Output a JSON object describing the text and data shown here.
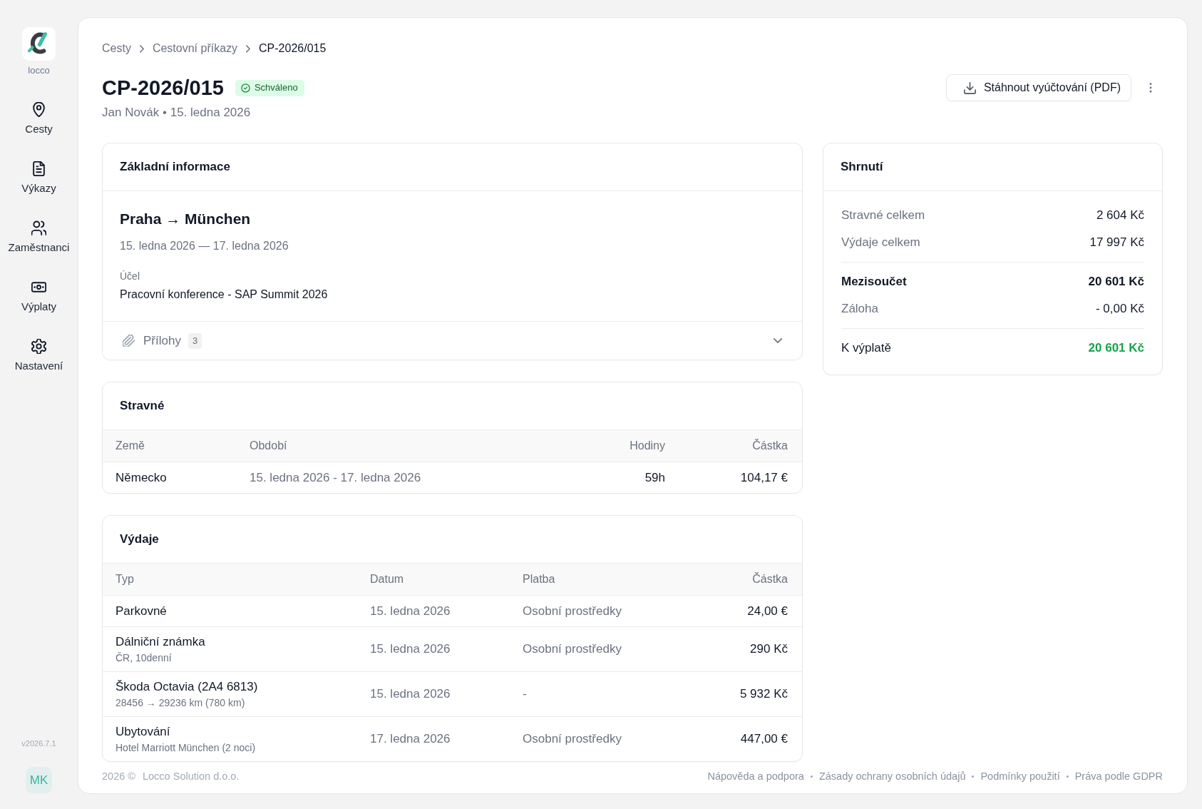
{
  "sidebar": {
    "brand": "locco",
    "items": [
      {
        "label": "Cesty"
      },
      {
        "label": "Výkazy"
      },
      {
        "label": "Zaměstnanci"
      },
      {
        "label": "Výplaty"
      },
      {
        "label": "Nastavení"
      }
    ],
    "version": "v2026.7.1",
    "user_initials": "MK"
  },
  "breadcrumb": [
    "Cesty",
    "Cestovní příkazy",
    "CP-2026/015"
  ],
  "header": {
    "title": "CP-2026/015",
    "status": "Schváleno",
    "subtitle": "Jan Novák • 15. ledna 2026",
    "download_button": "Stáhnout vyúčtování (PDF)"
  },
  "basic_info": {
    "title": "Základní informace",
    "route": "Praha → München",
    "dates": "15. ledna 2026 — 17. ledna 2026",
    "purpose_label": "Účel",
    "purpose": "Pracovní konference - SAP Summit 2026",
    "attachments": {
      "label": "Přílohy",
      "count": "3",
      "expanded": false
    }
  },
  "per_diem": {
    "title": "Stravné",
    "columns": [
      "Země",
      "Období",
      "Hodiny",
      "Částka"
    ],
    "rows": [
      {
        "country": "Německo",
        "period": "15. ledna 2026 - 17. ledna 2026",
        "hours": "59h",
        "amount": "104,17 €"
      }
    ]
  },
  "expenses": {
    "title": "Výdaje",
    "columns": [
      "Typ",
      "Datum",
      "Platba",
      "Částka"
    ],
    "rows": [
      {
        "type": "Parkovné",
        "date": "15. ledna 2026",
        "payment": "Osobní prostředky",
        "amount": "24,00 €"
      },
      {
        "type": "Dálniční známka",
        "detail": "ČR, 10denní",
        "date": "15. ledna 2026",
        "payment": "Osobní prostředky",
        "amount": "290 Kč"
      },
      {
        "type": "Škoda Octavia (2A4 6813)",
        "detail": "28456 → 29236 km (780 km)",
        "date": "15. ledna 2026",
        "payment": "-",
        "amount": "5 932 Kč"
      },
      {
        "type": "Ubytování",
        "detail": "Hotel Marriott München (2 noci)",
        "date": "17. ledna 2026",
        "payment": "Osobní prostředky",
        "amount": "447,00 €"
      }
    ]
  },
  "summary": {
    "title": "Shrnutí",
    "rows": [
      {
        "kind": "item",
        "label": "Stravné celkem",
        "value": "2 604 Kč"
      },
      {
        "kind": "item",
        "label": "Výdaje celkem",
        "value": "17 997 Kč"
      },
      {
        "kind": "subtotal",
        "label": "Mezisoučet",
        "value": "20 601 Kč"
      },
      {
        "kind": "item",
        "label": "Záloha",
        "value": "- 0,00 Kč"
      },
      {
        "kind": "total",
        "label": "K výplatě",
        "value": "20 601 Kč"
      }
    ]
  },
  "footer": {
    "year": "2026 ©",
    "company": "Locco Solution d.o.o.",
    "links": [
      "Nápověda a podpora",
      "Zásady ochrany osobních údajů",
      "Podmínky použití",
      "Práva podle GDPR"
    ]
  }
}
